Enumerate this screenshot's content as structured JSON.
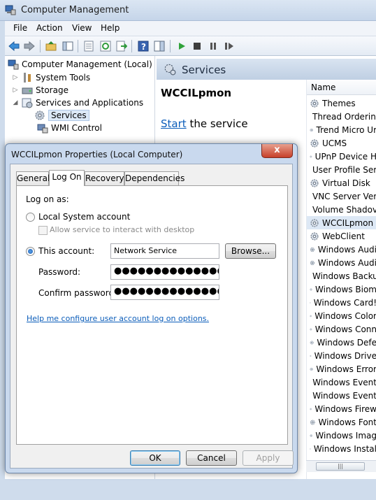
{
  "window": {
    "title": "Computer Management"
  },
  "menu": [
    "File",
    "Action",
    "View",
    "Help"
  ],
  "toolbar_icons": [
    "back-arrow-icon",
    "forward-arrow-icon",
    "up-folder-icon",
    "show-hide-tree-icon",
    "properties-icon",
    "refresh-icon",
    "export-list-icon",
    "help-icon",
    "action-pane-icon",
    "start-service-icon",
    "stop-service-icon",
    "pause-service-icon",
    "restart-service-icon"
  ],
  "tree": {
    "root": "Computer Management (Local)",
    "system_tools": "System Tools",
    "storage": "Storage",
    "services_apps": "Services and Applications",
    "services": "Services",
    "wmi": "WMI Control"
  },
  "right_pane": {
    "header": "Services",
    "selected_service": "WCCILpmon",
    "start_link": "Start",
    "start_suffix": "the service",
    "column_name": "Name",
    "services": [
      "Themes",
      "Thread Ordering",
      "Trend Micro Ur",
      "UCMS",
      "UPnP Device H",
      "User Profile Ser",
      "Virtual Disk",
      "VNC Server Ver",
      "Volume Shadov",
      "WCCILpmon",
      "WebClient",
      "Windows Audi",
      "Windows Audi",
      "Windows Backu",
      "Windows Biom",
      "Windows Card!",
      "Windows Color",
      "Windows Conn",
      "Windows Defe",
      "Windows Drive",
      "Windows Error",
      "Windows Event",
      "Windows Event",
      "Windows Firew",
      "Windows Font",
      "Windows Imag",
      "Windows Instal"
    ],
    "selected_index": 9,
    "scroll_thumb": "|||"
  },
  "dialog": {
    "title": "WCCILpmon Properties (Local Computer)",
    "close": "x",
    "tabs": [
      "General",
      "Log On",
      "Recovery",
      "Dependencies"
    ],
    "active_tab": "Log On",
    "logon_as": "Log on as:",
    "local_system": "Local System account",
    "allow_interact": "Allow service to interact with desktop",
    "this_account": "This account:",
    "account_value": "Network Service",
    "browse": "Browse...",
    "password_label": "Password:",
    "password_value": "●●●●●●●●●●●●●●●",
    "confirm_label": "Confirm password:",
    "confirm_value": "●●●●●●●●●●●●●●●",
    "help_link": "Help me configure user account log on options.",
    "ok": "OK",
    "cancel": "Cancel",
    "apply": "Apply"
  }
}
